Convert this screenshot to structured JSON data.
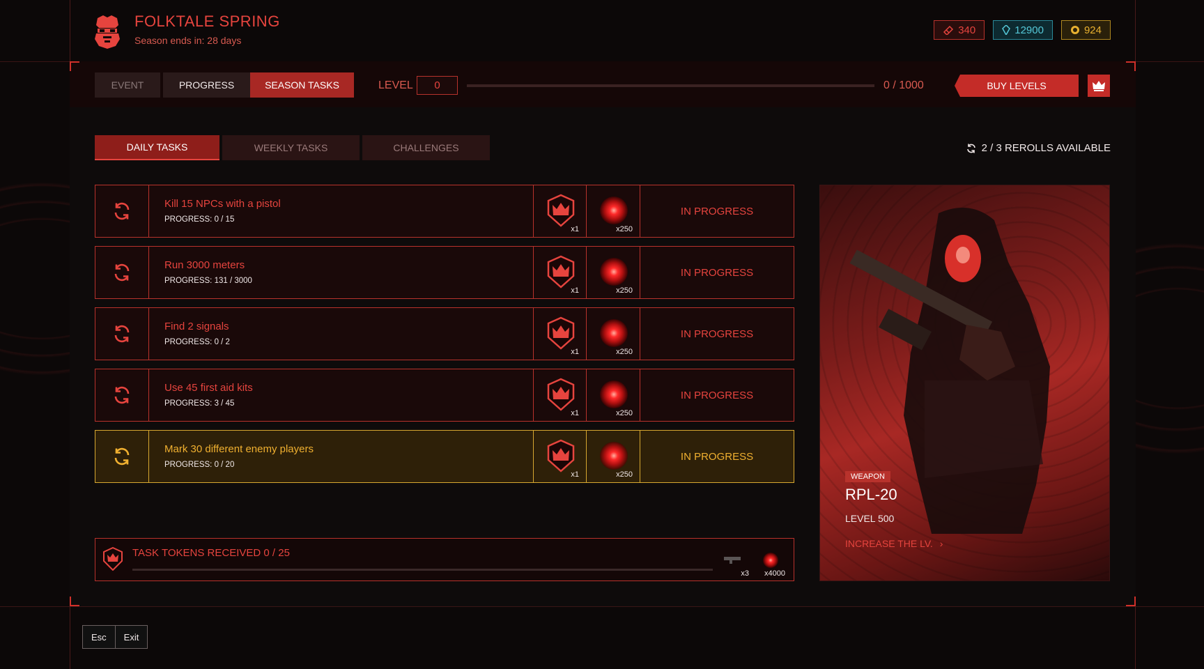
{
  "header": {
    "title": "FOLKTALE SPRING",
    "subtitle": "Season ends in: 28 days",
    "currencies": [
      {
        "icon": "ticket-icon",
        "value": "340",
        "color": "#e6443e"
      },
      {
        "icon": "crystal-icon",
        "value": "12900",
        "color": "#55c8d8"
      },
      {
        "icon": "coin-icon",
        "value": "924",
        "color": "#e8b030"
      }
    ]
  },
  "toolbar": {
    "tabs": [
      {
        "label": "EVENT",
        "state": "disabled"
      },
      {
        "label": "PROGRESS",
        "state": "normal"
      },
      {
        "label": "SEASON TASKS",
        "state": "active"
      }
    ],
    "level_label": "LEVEL",
    "level_value": "0",
    "level_progress_text": "0 / 1000",
    "level_progress": 0,
    "buy_levels": "BUY LEVELS",
    "crown_icon": "crown-icon"
  },
  "subtabs": [
    {
      "label": "DAILY TASKS",
      "active": true
    },
    {
      "label": "WEEKLY TASKS",
      "active": false
    },
    {
      "label": "CHALLENGES",
      "active": false
    }
  ],
  "rerolls": "2 / 3 REROLLS AVAILABLE",
  "tasks": [
    {
      "name": "Kill 15 NPCs with a pistol",
      "progress": "PROGRESS: 0 / 15",
      "reward1": "x1",
      "reward2": "x250",
      "status": "IN PROGRESS",
      "highlight": false
    },
    {
      "name": "Run 3000 meters",
      "progress": "PROGRESS: 131 / 3000",
      "reward1": "x1",
      "reward2": "x250",
      "status": "IN PROGRESS",
      "highlight": false
    },
    {
      "name": "Find 2 signals",
      "progress": "PROGRESS: 0 / 2",
      "reward1": "x1",
      "reward2": "x250",
      "status": "IN PROGRESS",
      "highlight": false
    },
    {
      "name": "Use 45 first aid kits",
      "progress": "PROGRESS: 3 / 45",
      "reward1": "x1",
      "reward2": "x250",
      "status": "IN PROGRESS",
      "highlight": false
    },
    {
      "name": "Mark 30 different enemy players",
      "progress": "PROGRESS: 0 / 20",
      "reward1": "x1",
      "reward2": "x250",
      "status": "IN PROGRESS",
      "highlight": true
    }
  ],
  "tokens": {
    "label": "TASK TOKENS RECEIVED 0 / 25",
    "progress": 0,
    "reward1": "x3",
    "reward2": "x4000"
  },
  "card": {
    "badge": "WEAPON",
    "name": "RPL-20",
    "level": "LEVEL 500",
    "link": "INCREASE THE LV."
  },
  "footer": {
    "esc": "Esc",
    "exit": "Exit"
  }
}
